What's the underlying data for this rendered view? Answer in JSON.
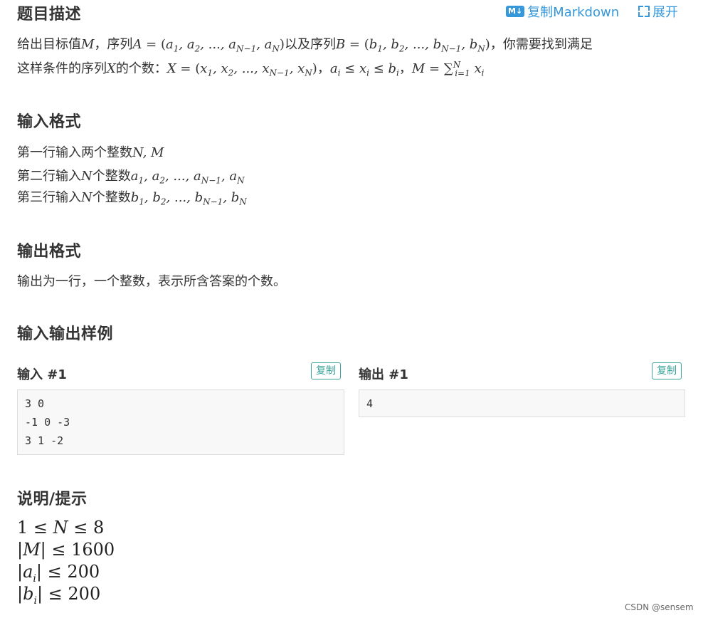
{
  "header": {
    "title": "题目描述",
    "copy_markdown_badge": "M↓",
    "copy_markdown_label": "复制Markdown",
    "expand_label": "展开"
  },
  "description": {
    "line1_a": "给出目标值",
    "var_M": "M",
    "line1_b": "，序列",
    "line1_c": "以及序列",
    "line1_d": "，你需要找到满足",
    "line2_a": "这样条件的序列",
    "var_X": "X",
    "line2_b": "的个数："
  },
  "input_format": {
    "title": "输入格式",
    "line1": "第一行输入两个整数",
    "line2": "第二行输入",
    "line3": "第三行输入",
    "count_word": "个整数"
  },
  "output_format": {
    "title": "输出格式",
    "text": "输出为一行，一个整数，表示所含答案的个数。"
  },
  "samples": {
    "title": "输入输出样例",
    "input_label": "输入 #1",
    "output_label": "输出 #1",
    "copy_label": "复制",
    "input_text": "3 0\n-1 0 -3\n3 1 -2",
    "output_text": "4"
  },
  "hints": {
    "title": "说明/提示",
    "l1": "1 ≤ N ≤ 8",
    "l2": "|M| ≤ 1600",
    "l3": "|a_i| ≤ 200",
    "l4": "|b_i| ≤ 200"
  },
  "watermark": "CSDN @sensem",
  "colors": {
    "link": "#3498db",
    "copy_btn": "#3aa39b",
    "code_bg": "#f8f8f8"
  }
}
